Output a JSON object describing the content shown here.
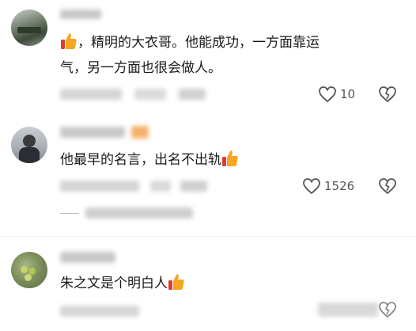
{
  "comments": [
    {
      "text_line1": "，精明的大衣哥。他能成功，一方面靠运",
      "text_line2": "气，另一方面也很会做人。",
      "likes": "10"
    },
    {
      "text_line1": "他最早的名言，出名不出轨",
      "likes": "1526"
    },
    {
      "text_line1": "朱之文是个明白人"
    }
  ],
  "colors": {
    "thumb": "#f5a623",
    "icon": "#555555"
  }
}
